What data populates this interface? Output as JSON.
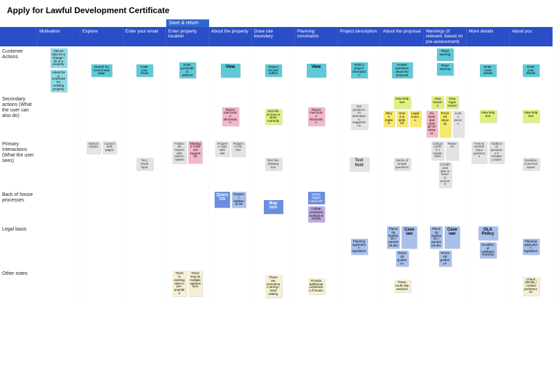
{
  "title": "Apply for Lawful Development Certificate",
  "save_return": "Save & return",
  "columns": [
    "",
    "Motivation",
    "Explore",
    "Enter your email",
    "Enter property location",
    "About the property",
    "Draw site boundary",
    "Planning constraints",
    "Project description",
    "About the proposal",
    "Warnings (if relevant, based on pre-assessment)",
    "More details",
    "About you"
  ],
  "rows": {
    "customer": "Customer Actions",
    "secondary": "Secondary actions (What the user can also do)",
    "primary": "Primary Interactions (What the user sees)",
    "backhouse": "Back of house processes",
    "legal": "Legal basis",
    "other": "Other notes"
  },
  "notes": {
    "cust_mot1": "Has an idea for a change / bit of a property",
    "cust_mot2": "Asked for a certificate for existing property",
    "cust_explore": "Search for council web page",
    "cust_email": "Enter your email",
    "cust_loc": "Enter postcode & address",
    "cust_about": "View",
    "cust_draw": "Draw a red site outline",
    "cust_plan": "View",
    "cust_proj": "Write a project description",
    "cust_prop1": "Answer questions about the proposal",
    "cust_warn1": "Read warning",
    "cust_warn2": "Read warning",
    "cust_more": "Enter more details",
    "cust_you": "Enter your details",
    "sec_about": "Report inaccurate information",
    "sec_draw": "Get info on how to draw correctly",
    "sec_plan": "Report inaccurate information",
    "sec_proj": "See guidance on description suggestions",
    "sec_prop_help": "View help text",
    "sec_prop_why": "Why it matters",
    "sec_prop_how": "How it is defined",
    "sec_prop_legal": "Legal source",
    "sec_warn_reasons": "View reasons",
    "sec_warn_legal": "View legal source",
    "sec_warn_goback": "Go back and change an answer",
    "sec_warn_proceed": "Proceed anyway",
    "sec_warn_leave": "Leave service",
    "sec_more_help": "View help text",
    "sec_you_help": "View help text",
    "pri_explore1": "Search engine",
    "pri_explore2": "Council web pages",
    "pri_email": "Text, email input",
    "pri_loc1": "Postcode search with autocomplete",
    "pri_loc2": "Message if site not supported",
    "pri_about1": "Property map with site",
    "pri_about2": "Property info text",
    "pri_draw": "Red line drawing tool",
    "pri_proj": "Text field",
    "pri_prop": "Series of simple questions",
    "pri_warn1": "Critical confirm / explanation",
    "pri_warn2": "Reasons",
    "pri_warn3": "Conditional offer to leave or proceed",
    "pri_more1": "Free & number input questions",
    "pri_more2": "Additional questions if Greater London",
    "pri_you": "Questions and text inputs",
    "bh_about1": "Query OS",
    "bh_about2": "Request additional set",
    "bh_draw": "Map tool",
    "bh_plan1": "Query Digital Land API",
    "bh_plan2": "Collate constraint lookups & results",
    "lg_proj1": "Planning application legislation",
    "lg_prop1": "Planning legislation / permitted dev",
    "lg_prop2": "Technical guidance",
    "lg_prop3": "Case law",
    "lg_warn1": "Planning legislation / permitted dev",
    "lg_warn2": "Technical guidance",
    "lg_warn3": "Case law",
    "lg_more1": "GLA Policy",
    "lg_more2": "Small/local validation checklist",
    "lg_you": "Planning application legislation",
    "oth_loc1": "There is existing data to pre-populate",
    "oth_loc2": "There may be multiple applications",
    "oth_draw": "These are sometimes wrong / need editing",
    "oth_plan": "Provide additional constraints if known",
    "oth_prop": "These could skip sections",
    "oth_you": "Check identity / contact preferences"
  }
}
